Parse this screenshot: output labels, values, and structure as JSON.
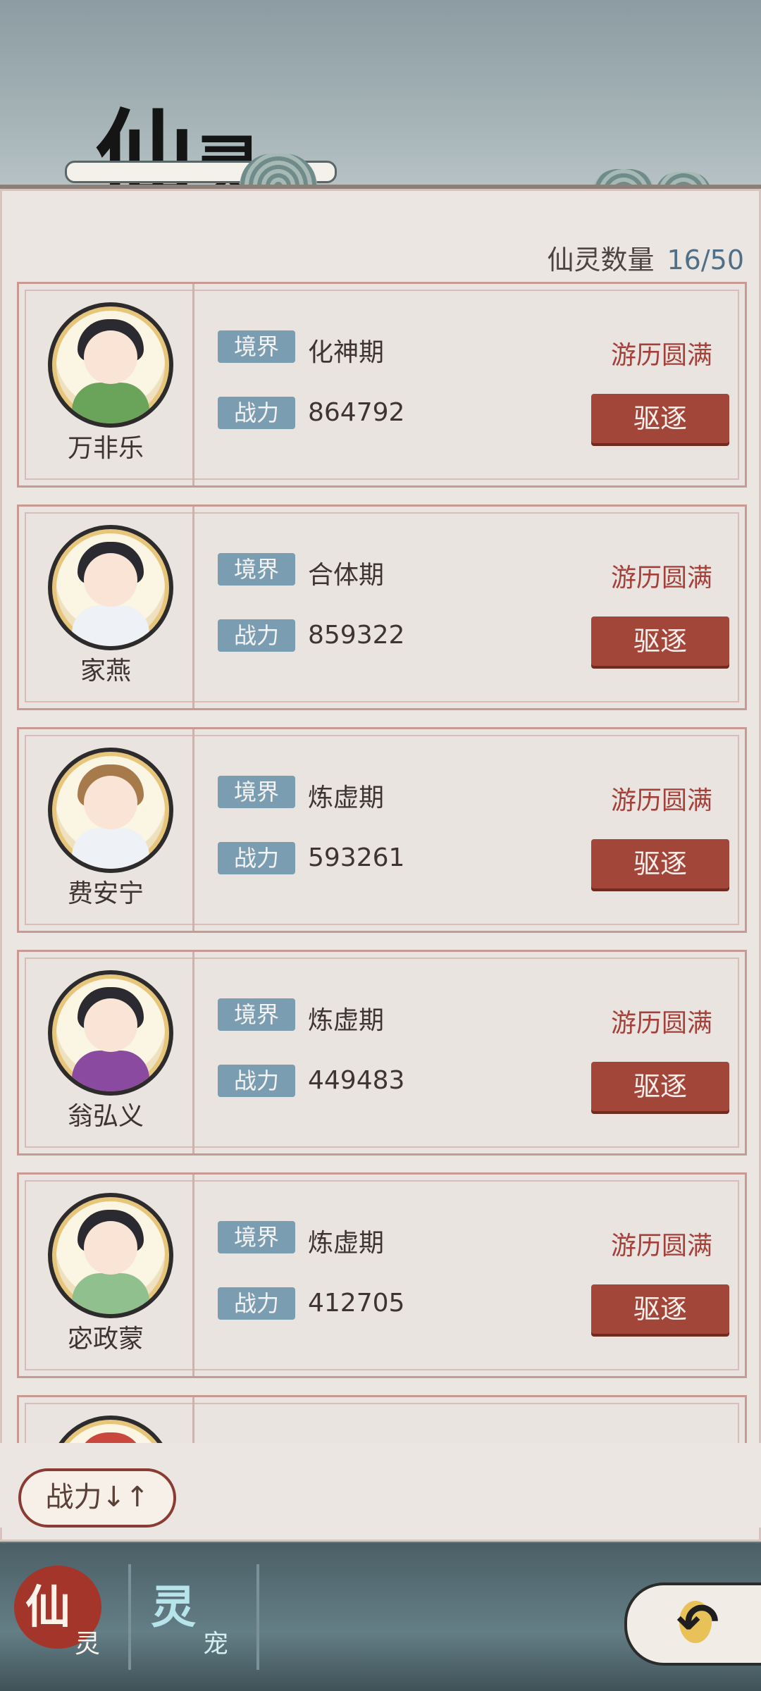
{
  "header": {
    "title_char1": "仙",
    "title_char2": "灵"
  },
  "count": {
    "label": "仙灵数量",
    "value": "16/50"
  },
  "labels": {
    "realm": "境界",
    "power": "战力",
    "expel": "驱逐"
  },
  "spirits": [
    {
      "name": "万非乐",
      "realm": "化神期",
      "power": "864792",
      "status": "游历圆满",
      "robe_color": "#6aa45a"
    },
    {
      "name": "家燕",
      "realm": "合体期",
      "power": "859322",
      "status": "游历圆满",
      "robe_color": "#eef1f5"
    },
    {
      "name": "费安宁",
      "realm": "炼虚期",
      "power": "593261",
      "status": "游历圆满",
      "robe_color": "#eef1f5"
    },
    {
      "name": "翁弘义",
      "realm": "炼虚期",
      "power": "449483",
      "status": "游历圆满",
      "robe_color": "#8a4aa0"
    },
    {
      "name": "宓政蒙",
      "realm": "炼虚期",
      "power": "412705",
      "status": "游历圆满",
      "robe_color": "#8fc08d"
    }
  ],
  "sort": {
    "label": "战力↓↑"
  },
  "tabs": [
    {
      "main": "仙",
      "sub": "灵"
    },
    {
      "main": "灵",
      "sub": "宠"
    }
  ],
  "back": {
    "icon": "back-arrow-icon",
    "glyph": "↶"
  },
  "colors": {
    "accent_red": "#a2463a",
    "tag_blue": "#7b9db2",
    "count_blue": "#4f6f88",
    "status_red": "#a4403a"
  }
}
